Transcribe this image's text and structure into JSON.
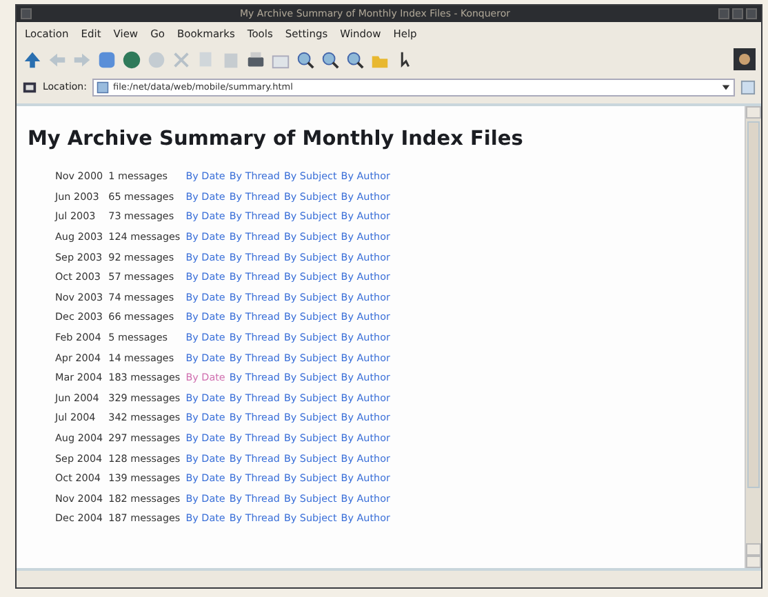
{
  "window": {
    "title": "My Archive Summary of Monthly Index Files - Konqueror"
  },
  "menu": [
    "Location",
    "Edit",
    "View",
    "Go",
    "Bookmarks",
    "Tools",
    "Settings",
    "Window",
    "Help"
  ],
  "location_bar": {
    "label": "Location:",
    "value": "file:/net/data/web/mobile/summary.html"
  },
  "page": {
    "heading": "My Archive Summary of Monthly Index Files",
    "rows": [
      {
        "month": "Nov 2000",
        "count": "1 messages",
        "links": [
          {
            "text": "By Date",
            "visited": false
          },
          {
            "text": "By Thread",
            "visited": false
          },
          {
            "text": "By Subject",
            "visited": false
          },
          {
            "text": "By Author",
            "visited": false
          }
        ]
      },
      {
        "month": "Jun 2003",
        "count": "65 messages",
        "links": [
          {
            "text": "By Date",
            "visited": false
          },
          {
            "text": "By Thread",
            "visited": false
          },
          {
            "text": "By Subject",
            "visited": false
          },
          {
            "text": "By Author",
            "visited": false
          }
        ]
      },
      {
        "month": "Jul 2003",
        "count": "73 messages",
        "links": [
          {
            "text": "By Date",
            "visited": false
          },
          {
            "text": "By Thread",
            "visited": false
          },
          {
            "text": "By Subject",
            "visited": false
          },
          {
            "text": "By Author",
            "visited": false
          }
        ]
      },
      {
        "month": "Aug 2003",
        "count": "124 messages",
        "links": [
          {
            "text": "By Date",
            "visited": false
          },
          {
            "text": "By Thread",
            "visited": false
          },
          {
            "text": "By Subject",
            "visited": false
          },
          {
            "text": "By Author",
            "visited": false
          }
        ]
      },
      {
        "month": "Sep 2003",
        "count": "92 messages",
        "links": [
          {
            "text": "By Date",
            "visited": false
          },
          {
            "text": "By Thread",
            "visited": false
          },
          {
            "text": "By Subject",
            "visited": false
          },
          {
            "text": "By Author",
            "visited": false
          }
        ]
      },
      {
        "month": "Oct 2003",
        "count": "57 messages",
        "links": [
          {
            "text": "By Date",
            "visited": false
          },
          {
            "text": "By Thread",
            "visited": false
          },
          {
            "text": "By Subject",
            "visited": false
          },
          {
            "text": "By Author",
            "visited": false
          }
        ]
      },
      {
        "month": "Nov 2003",
        "count": "74 messages",
        "links": [
          {
            "text": "By Date",
            "visited": false
          },
          {
            "text": "By Thread",
            "visited": false
          },
          {
            "text": "By Subject",
            "visited": false
          },
          {
            "text": "By Author",
            "visited": false
          }
        ]
      },
      {
        "month": "Dec 2003",
        "count": "66 messages",
        "links": [
          {
            "text": "By Date",
            "visited": false
          },
          {
            "text": "By Thread",
            "visited": false
          },
          {
            "text": "By Subject",
            "visited": false
          },
          {
            "text": "By Author",
            "visited": false
          }
        ]
      },
      {
        "month": "Feb 2004",
        "count": "5 messages",
        "links": [
          {
            "text": "By Date",
            "visited": false
          },
          {
            "text": "By Thread",
            "visited": false
          },
          {
            "text": "By Subject",
            "visited": false
          },
          {
            "text": "By Author",
            "visited": false
          }
        ]
      },
      {
        "month": "Apr 2004",
        "count": "14 messages",
        "links": [
          {
            "text": "By Date",
            "visited": false
          },
          {
            "text": "By Thread",
            "visited": false
          },
          {
            "text": "By Subject",
            "visited": false
          },
          {
            "text": "By Author",
            "visited": false
          }
        ]
      },
      {
        "month": "Mar 2004",
        "count": "183 messages",
        "links": [
          {
            "text": "By Date",
            "visited": true
          },
          {
            "text": "By Thread",
            "visited": false
          },
          {
            "text": "By Subject",
            "visited": false
          },
          {
            "text": "By Author",
            "visited": false
          }
        ]
      },
      {
        "month": "Jun 2004",
        "count": "329 messages",
        "links": [
          {
            "text": "By Date",
            "visited": false
          },
          {
            "text": "By Thread",
            "visited": false
          },
          {
            "text": "By Subject",
            "visited": false
          },
          {
            "text": "By Author",
            "visited": false
          }
        ]
      },
      {
        "month": "Jul 2004",
        "count": "342 messages",
        "links": [
          {
            "text": "By Date",
            "visited": false
          },
          {
            "text": "By Thread",
            "visited": false
          },
          {
            "text": "By Subject",
            "visited": false
          },
          {
            "text": "By Author",
            "visited": false
          }
        ]
      },
      {
        "month": "Aug 2004",
        "count": "297 messages",
        "links": [
          {
            "text": "By Date",
            "visited": false
          },
          {
            "text": "By Thread",
            "visited": false
          },
          {
            "text": "By Subject",
            "visited": false
          },
          {
            "text": "By Author",
            "visited": false
          }
        ]
      },
      {
        "month": "Sep 2004",
        "count": "128 messages",
        "links": [
          {
            "text": "By Date",
            "visited": false
          },
          {
            "text": "By Thread",
            "visited": false
          },
          {
            "text": "By Subject",
            "visited": false
          },
          {
            "text": "By Author",
            "visited": false
          }
        ]
      },
      {
        "month": "Oct 2004",
        "count": "139 messages",
        "links": [
          {
            "text": "By Date",
            "visited": false
          },
          {
            "text": "By Thread",
            "visited": false
          },
          {
            "text": "By Subject",
            "visited": false
          },
          {
            "text": "By Author",
            "visited": false
          }
        ]
      },
      {
        "month": "Nov 2004",
        "count": "182 messages",
        "links": [
          {
            "text": "By Date",
            "visited": false
          },
          {
            "text": "By Thread",
            "visited": false
          },
          {
            "text": "By Subject",
            "visited": false
          },
          {
            "text": "By Author",
            "visited": false
          }
        ]
      },
      {
        "month": "Dec 2004",
        "count": "187 messages",
        "links": [
          {
            "text": "By Date",
            "visited": false
          },
          {
            "text": "By Thread",
            "visited": false
          },
          {
            "text": "By Subject",
            "visited": false
          },
          {
            "text": "By Author",
            "visited": false
          }
        ]
      }
    ]
  }
}
